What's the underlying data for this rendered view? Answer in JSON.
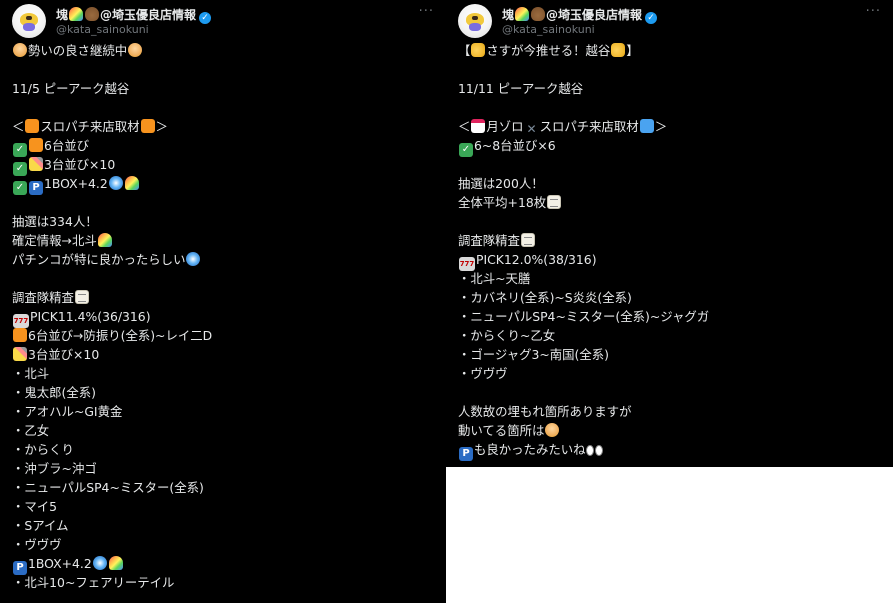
{
  "left": {
    "author": {
      "name": "塊",
      "name_suffix": "@埼玉優良店情報",
      "handle": "@kata_sainokuni"
    },
    "more_label": "···",
    "lines": [
      [
        {
          "e": "face"
        },
        {
          "t": "勢いの良さ継続中"
        },
        {
          "e": "face"
        }
      ],
      [],
      [
        {
          "t": "11/5 ピーアーク越谷"
        }
      ],
      [],
      [
        {
          "t": "＜"
        },
        {
          "e": "orange"
        },
        {
          "t": "スロパチ来店取材"
        },
        {
          "e": "orange"
        },
        {
          "t": "＞"
        }
      ],
      [
        {
          "e": "check"
        },
        {
          "e": "orange"
        },
        {
          "t": "6台並び"
        }
      ],
      [
        {
          "e": "check"
        },
        {
          "e": "pencil"
        },
        {
          "t": "3台並び×10"
        }
      ],
      [
        {
          "e": "check"
        },
        {
          "e": "p"
        },
        {
          "t": "1BOX+4.2"
        },
        {
          "e": "swirl"
        },
        {
          "e": "rainbow"
        }
      ],
      [],
      [
        {
          "t": "抽選は334人！"
        }
      ],
      [
        {
          "t": "確定情報→北斗"
        },
        {
          "e": "rainbow"
        }
      ],
      [
        {
          "t": "パチンコが特に良かったらしい"
        },
        {
          "e": "swirl"
        }
      ],
      [],
      [
        {
          "t": "調査隊精査"
        },
        {
          "e": "memo"
        }
      ],
      [
        {
          "e": "slot"
        },
        {
          "t": "PICK11.4%(36/316)"
        }
      ],
      [
        {
          "e": "orange"
        },
        {
          "t": "6台並び→防振り(全系)~レイ二D"
        }
      ],
      [
        {
          "e": "pencil"
        },
        {
          "t": "3台並び×10"
        }
      ],
      [
        {
          "t": "・北斗"
        }
      ],
      [
        {
          "t": "・鬼太郎(全系)"
        }
      ],
      [
        {
          "t": "・アオハル~GI黄金"
        }
      ],
      [
        {
          "t": "・乙女"
        }
      ],
      [
        {
          "t": "・からくり"
        }
      ],
      [
        {
          "t": "・沖ブラ~沖ゴ"
        }
      ],
      [
        {
          "t": "・ニューパルSP4~ミスター(全系)"
        }
      ],
      [
        {
          "t": "・マイ5"
        }
      ],
      [
        {
          "t": "・Sアイム"
        }
      ],
      [
        {
          "t": "・ヴヴヴ"
        }
      ],
      [
        {
          "e": "p"
        },
        {
          "t": "1BOX+4.2"
        },
        {
          "e": "swirl"
        },
        {
          "e": "rainbow"
        }
      ],
      [
        {
          "t": "・北斗10~フェアリーテイル"
        }
      ]
    ]
  },
  "right": {
    "author": {
      "name": "塊",
      "name_suffix": "@埼玉優良店情報",
      "handle": "@kata_sainokuni"
    },
    "more_label": "···",
    "lines": [
      [
        {
          "t": "【"
        },
        {
          "e": "thumb"
        },
        {
          "t": "さすが今推せる！越谷"
        },
        {
          "e": "thumb"
        },
        {
          "t": "】"
        }
      ],
      [],
      [
        {
          "t": "11/11 ピーアーク越谷"
        }
      ],
      [],
      [
        {
          "t": "＜"
        },
        {
          "e": "cal"
        },
        {
          "t": "月ゾロ"
        },
        {
          "e": "x"
        },
        {
          "t": "スロパチ来店取材"
        },
        {
          "e": "blue"
        },
        {
          "t": "＞"
        }
      ],
      [
        {
          "e": "check"
        },
        {
          "t": "6~8台並び×6"
        }
      ],
      [],
      [
        {
          "t": "抽選は200人！"
        }
      ],
      [
        {
          "t": "全体平均+18枚"
        },
        {
          "e": "memo"
        }
      ],
      [],
      [
        {
          "t": "調査隊精査"
        },
        {
          "e": "memo"
        }
      ],
      [
        {
          "e": "slot"
        },
        {
          "t": "PICK12.0%(38/316)"
        }
      ],
      [
        {
          "t": "・北斗~天膳"
        }
      ],
      [
        {
          "t": "・カバネリ(全系)~S炎炎(全系)"
        }
      ],
      [
        {
          "t": "・ニューパルSP4~ミスター(全系)~ジャグガ"
        }
      ],
      [
        {
          "t": "・からくり~乙女"
        }
      ],
      [
        {
          "t": "・ゴージャグ3~南国(全系)"
        }
      ],
      [
        {
          "t": "・ヴヴヴ"
        }
      ],
      [],
      [
        {
          "t": "人数故の埋もれ箇所ありますが"
        }
      ],
      [
        {
          "t": "動いてる箇所は"
        },
        {
          "e": "face"
        }
      ],
      [
        {
          "e": "p"
        },
        {
          "t": "も良かったみたいね"
        },
        {
          "e": "eyes"
        },
        {
          "e": "eyes"
        }
      ]
    ]
  },
  "emoji_glyphs": {
    "check": "✓",
    "p": "P",
    "slot": "777",
    "x": "✕"
  },
  "colors": {
    "background": "#000000",
    "text": "#e7e9ea",
    "handle": "#71767b",
    "verified": "#1d9bf0",
    "gutter": "#ffffff"
  }
}
